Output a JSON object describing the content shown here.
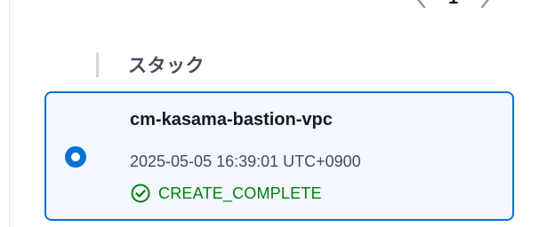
{
  "pagination": {
    "current_page": "1",
    "prev_icon": "chevron-left-icon",
    "next_icon": "chevron-right-icon"
  },
  "table": {
    "column_header": "スタック"
  },
  "stack": {
    "name": "cm-kasama-bastion-vpc",
    "timestamp": "2025-05-05 16:39:01 UTC+0900",
    "status": "CREATE_COMPLETE",
    "status_icon": "check-circle-icon",
    "selected": true
  },
  "colors": {
    "accent": "#0972d3",
    "card_background": "#f2f8fd",
    "success": "#037f0c"
  }
}
